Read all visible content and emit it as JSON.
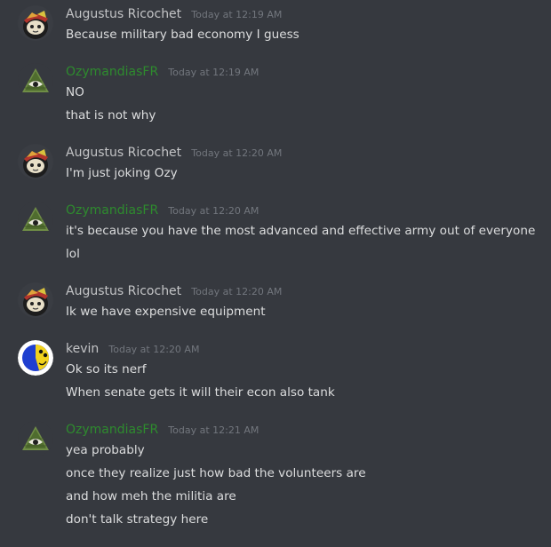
{
  "colors": {
    "background": "#36393f",
    "text": "#dcddde",
    "timestamp": "#72767d",
    "augustus_name": "#c3c4c6",
    "ozy_name": "#2e8b2e",
    "kevin_name": "#c3c4c6"
  },
  "messages": [
    {
      "avatar_icon": "cat-hat-avatar-icon",
      "username": "Augustus Ricochet",
      "timestamp": "Today at 12:19 AM",
      "lines": [
        "Because military bad economy I guess"
      ]
    },
    {
      "avatar_icon": "illuminati-eye-avatar-icon",
      "username": "OzymandiasFR",
      "timestamp": "Today at 12:19 AM",
      "lines": [
        "NO",
        "that is not why"
      ]
    },
    {
      "avatar_icon": "cat-hat-avatar-icon",
      "username": "Augustus Ricochet",
      "timestamp": "Today at 12:20 AM",
      "lines": [
        "I'm just joking Ozy"
      ]
    },
    {
      "avatar_icon": "illuminati-eye-avatar-icon",
      "username": "OzymandiasFR",
      "timestamp": "Today at 12:20 AM",
      "lines": [
        "it's because you have the most advanced and effective army out of everyone",
        "lol"
      ]
    },
    {
      "avatar_icon": "cat-hat-avatar-icon",
      "username": "Augustus Ricochet",
      "timestamp": "Today at 12:20 AM",
      "lines": [
        "Ik we have expensive equipment"
      ]
    },
    {
      "avatar_icon": "blue-yellow-face-avatar-icon",
      "username": "kevin",
      "timestamp": "Today at 12:20 AM",
      "lines": [
        "Ok so its nerf",
        "When senate gets it will their econ also tank"
      ]
    },
    {
      "avatar_icon": "illuminati-eye-avatar-icon",
      "username": "OzymandiasFR",
      "timestamp": "Today at 12:21 AM",
      "lines": [
        "yea probably",
        "once they realize just how bad the volunteers are",
        "and how meh the militia are",
        "don't talk strategy here"
      ]
    }
  ]
}
